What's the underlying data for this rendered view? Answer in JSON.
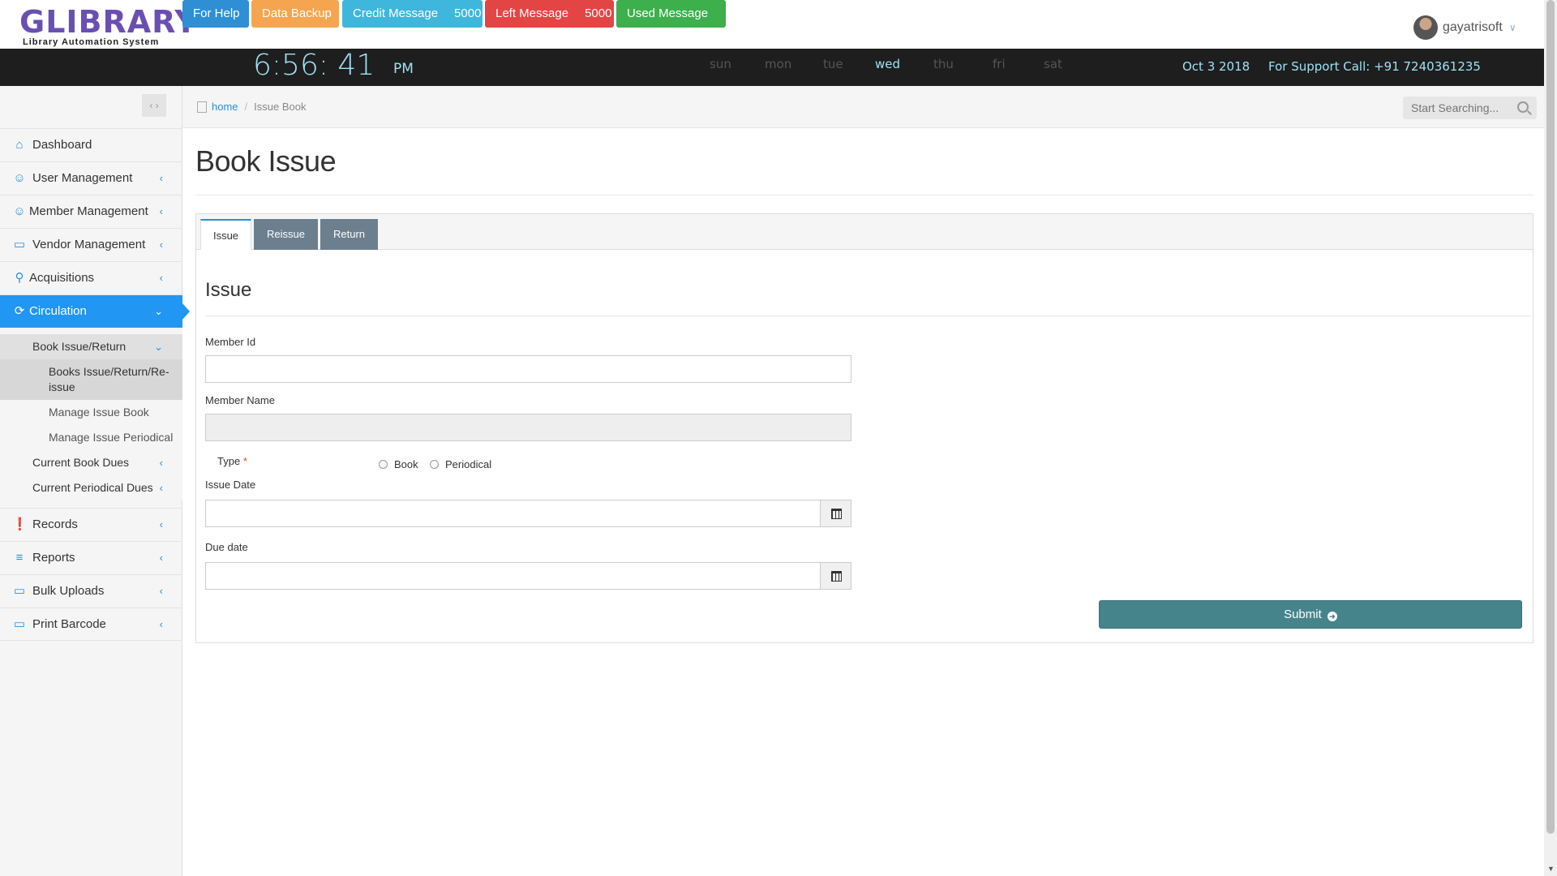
{
  "header": {
    "logo_text": "GLIBRARY",
    "logo_subtitle": "Library Automation System",
    "buttons": {
      "help": "For Help",
      "backup": "Data Backup",
      "credit_label": "Credit Message",
      "credit_count": "5000",
      "left_label": "Left Message",
      "left_count": "5000",
      "used_label": "Used Message"
    },
    "user": {
      "name": "gayatrisoft"
    },
    "colors": {
      "help": "#2e8fd4",
      "backup": "#f5a54f",
      "credit": "#3fb6dc",
      "left": "#e34545",
      "used": "#3daf4d"
    }
  },
  "clockbar": {
    "time": "6:56: 41",
    "ampm": "PM",
    "days": [
      "sun",
      "mon",
      "tue",
      "wed",
      "thu",
      "fri",
      "sat"
    ],
    "active_day": "wed",
    "date": "Oct 3 2018",
    "support": "For Support Call: +91 7240361235"
  },
  "sidebar": {
    "items": [
      {
        "label": "Dashboard",
        "icon": "home-icon"
      },
      {
        "label": "User Management",
        "icon": "user-icon"
      },
      {
        "label": "Member Management",
        "icon": "users-icon"
      },
      {
        "label": "Vendor Management",
        "icon": "monitor-icon"
      },
      {
        "label": "Acquisitions",
        "icon": "key-icon"
      },
      {
        "label": "Circulation",
        "icon": "refresh-icon"
      },
      {
        "label": "Records",
        "icon": "alert-icon"
      },
      {
        "label": "Reports",
        "icon": "layers-icon"
      },
      {
        "label": "Bulk Uploads",
        "icon": "monitor-icon"
      },
      {
        "label": "Print Barcode",
        "icon": "monitor-icon"
      }
    ],
    "circulation_sub": {
      "book_issue_return": "Book Issue/Return",
      "books_issue_return_reissue": "Books Issue/Return/Re-issue",
      "manage_issue_book": "Manage Issue Book",
      "manage_issue_periodical": "Manage Issue Periodical",
      "current_book_dues": "Current Book Dues",
      "current_periodical_dues": "Current Periodical Dues"
    },
    "active_color": "#2196f3"
  },
  "breadcrumb": {
    "home": "home",
    "current": "Issue Book"
  },
  "search": {
    "placeholder": "Start Searching..."
  },
  "main": {
    "title": "Book Issue",
    "tabs": [
      "Issue",
      "Reissue",
      "Return"
    ],
    "section_title": "Issue",
    "form": {
      "member_id_label": "Member Id",
      "member_id_value": "",
      "member_name_label": "Member Name",
      "member_name_value": "",
      "type_label": "Type",
      "required_mark": "*",
      "type_options": [
        "Book",
        "Periodical"
      ],
      "issue_date_label": "Issue Date",
      "due_date_label": "Due date",
      "submit_label": "Submit"
    }
  }
}
